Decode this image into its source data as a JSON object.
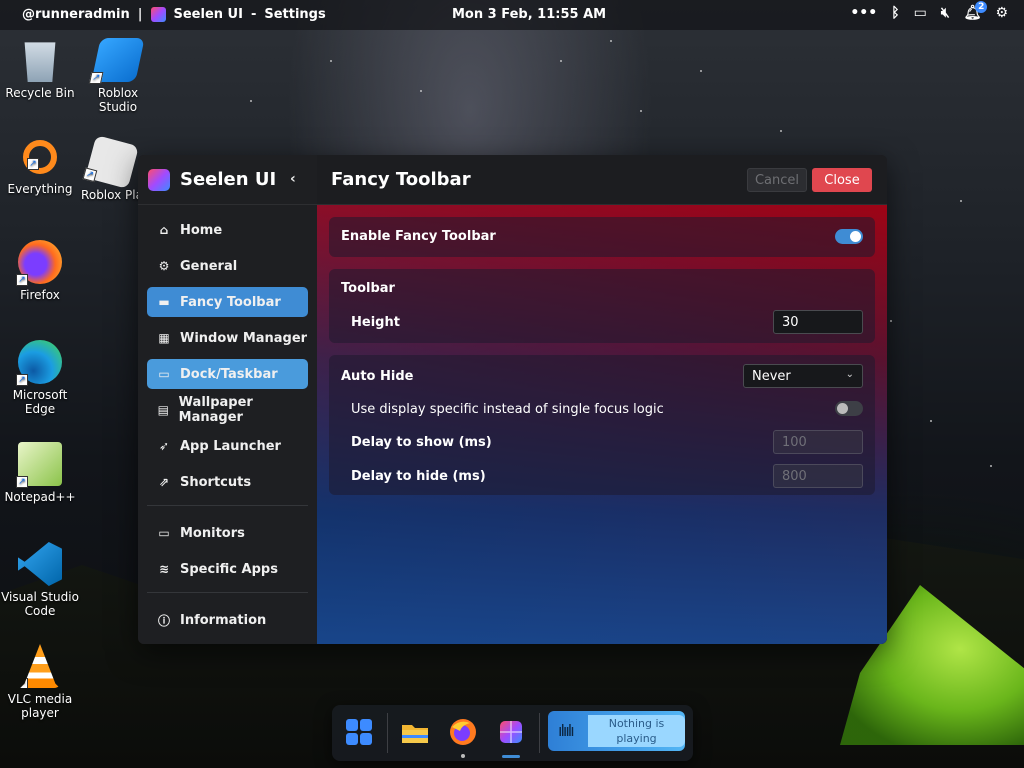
{
  "topbar": {
    "user": "@runneradmin",
    "separator": "|",
    "app_title": "Seelen UI",
    "window_title": "Settings",
    "datetime": "Mon 3 Feb, 11:55 AM",
    "notification_count": "2",
    "icons": [
      "more-icon",
      "bluetooth-icon",
      "display-icon",
      "volume-mute-icon",
      "notification-bell-icon",
      "settings-sliders-icon"
    ]
  },
  "desktop": {
    "icons": [
      {
        "label": "Recycle Bin",
        "icon": "recycle-bin-icon"
      },
      {
        "label": "Roblox Studio",
        "icon": "roblox-studio-icon"
      },
      {
        "label": "Everything",
        "icon": "everything-search-icon"
      },
      {
        "label": "Roblox Pla",
        "icon": "roblox-player-icon"
      },
      {
        "label": "Firefox",
        "icon": "firefox-icon"
      },
      {
        "label": "Microsoft Edge",
        "icon": "edge-icon"
      },
      {
        "label": "Notepad++",
        "icon": "notepadpp-icon"
      },
      {
        "label": "Visual Studio Code",
        "icon": "vscode-icon"
      },
      {
        "label": "VLC media player",
        "icon": "vlc-icon"
      }
    ]
  },
  "sidebar": {
    "brand": "Seelen UI",
    "collapse_glyph": "‹",
    "items": [
      {
        "label": "Home",
        "icon": "home-icon"
      },
      {
        "label": "General",
        "icon": "gear-icon"
      },
      {
        "label": "Fancy Toolbar",
        "icon": "toolbar-icon"
      },
      {
        "label": "Window Manager",
        "icon": "window-manager-icon"
      },
      {
        "label": "Dock/Taskbar",
        "icon": "dock-icon"
      },
      {
        "label": "Wallpaper Manager",
        "icon": "wallpaper-icon"
      },
      {
        "label": "App Launcher",
        "icon": "rocket-icon"
      },
      {
        "label": "Shortcuts",
        "icon": "shortcut-icon"
      },
      {
        "label": "Monitors",
        "icon": "monitor-icon"
      },
      {
        "label": "Specific Apps",
        "icon": "layers-icon"
      },
      {
        "label": "Information",
        "icon": "info-icon"
      }
    ]
  },
  "header": {
    "title": "Fancy Toolbar",
    "cancel_label": "Cancel",
    "close_label": "Close"
  },
  "settings": {
    "enable_label": "Enable Fancy Toolbar",
    "enable_value": true,
    "toolbar_section": "Toolbar",
    "height_label": "Height",
    "height_value": "30",
    "autohide_label": "Auto Hide",
    "autohide_value": "Never",
    "display_specific_label": "Use display specific instead of single focus logic",
    "display_specific_value": false,
    "delay_show_label": "Delay to show (ms)",
    "delay_show_value": "100",
    "delay_hide_label": "Delay to hide (ms)",
    "delay_hide_value": "800"
  },
  "dock": {
    "apps": [
      "start-menu-icon",
      "file-explorer-icon",
      "firefox-icon",
      "seelen-ui-icon"
    ],
    "media_text": "Nothing is playing",
    "media_icon": "sound-wave-icon"
  },
  "colors": {
    "accent": "#3f8cd4",
    "close_button": "#e0474f"
  }
}
